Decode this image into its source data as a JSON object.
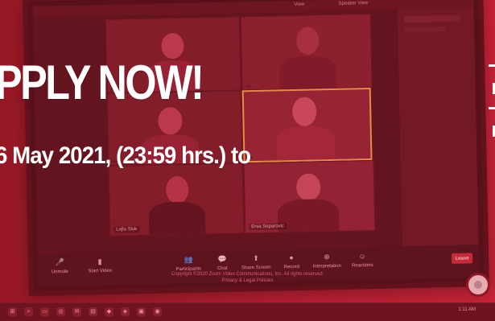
{
  "poster": {
    "headline": "PPLY NOW!",
    "subline": "6 May 2021, (23:59 hrs.) to"
  },
  "zoom": {
    "topbar": {
      "view": "View",
      "speaker": "Speaker View"
    },
    "participants": [
      {
        "name": ""
      },
      {
        "name": ""
      },
      {
        "name": ""
      },
      {
        "name": ""
      },
      {
        "name": "Lejla Sluk"
      },
      {
        "name": "Ersa Separovic"
      }
    ],
    "controls": [
      {
        "label": "Unmute",
        "icon": "mic-off-icon",
        "glyph": "🎤"
      },
      {
        "label": "Start Video",
        "icon": "camera-off-icon",
        "glyph": "▮"
      },
      {
        "label": "Participants",
        "icon": "people-icon",
        "glyph": "👥"
      },
      {
        "label": "Chat",
        "icon": "chat-icon",
        "glyph": "💬"
      },
      {
        "label": "Share Screen",
        "icon": "share-screen-icon",
        "glyph": "⬆"
      },
      {
        "label": "Record",
        "icon": "record-icon",
        "glyph": "●"
      },
      {
        "label": "Interpretation",
        "icon": "globe-icon",
        "glyph": "⊕"
      },
      {
        "label": "Reactions",
        "icon": "smile-icon",
        "glyph": "☺"
      }
    ],
    "leave_label": "Leave",
    "footer": {
      "copyright": "Copyright ©2020 Zoom Video Communications, Inc. All rights reserved.",
      "policies": "Privacy & Legal Policies"
    }
  },
  "taskbar": {
    "time": "1:11 AM"
  },
  "colors": {
    "brand_red": "#c42036",
    "text": "#ffffff",
    "speaker_highlight": "#f0c24b"
  }
}
